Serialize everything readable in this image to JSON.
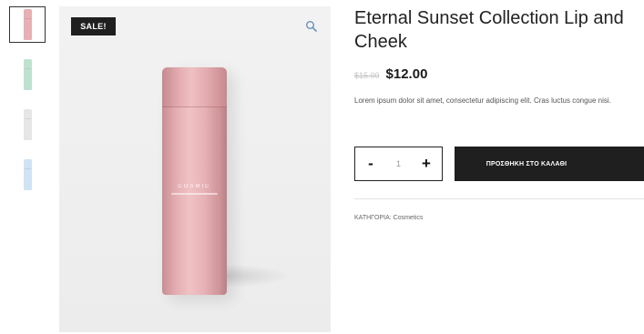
{
  "gallery": {
    "thumbnails": [
      {
        "color": "#e8b0b4",
        "active": true
      },
      {
        "color": "#bfe2d0",
        "active": false
      },
      {
        "color": "#e6e6e6",
        "active": false
      },
      {
        "color": "#cfe3f3",
        "active": false
      }
    ],
    "sale_badge": "SALE!",
    "zoom_icon": "magnifier-icon",
    "bottle_brand": "COSMIC"
  },
  "product": {
    "title": "Eternal Sunset Collection Lip and Cheek",
    "old_price": "$15.00",
    "price": "$12.00",
    "description": "Lorem ipsum dolor sit amet, consectetur adipiscing elit. Cras luctus congue nisi.",
    "quantity": "1",
    "minus_label": "-",
    "plus_label": "+",
    "add_to_cart": "ΠΡΟΣΘΗΚΗ ΣΤΟ ΚΑΛΑΘΙ",
    "category_label": "ΚΑΤΗΓΟΡΙΑ:",
    "category_value": "Cosmetics"
  }
}
